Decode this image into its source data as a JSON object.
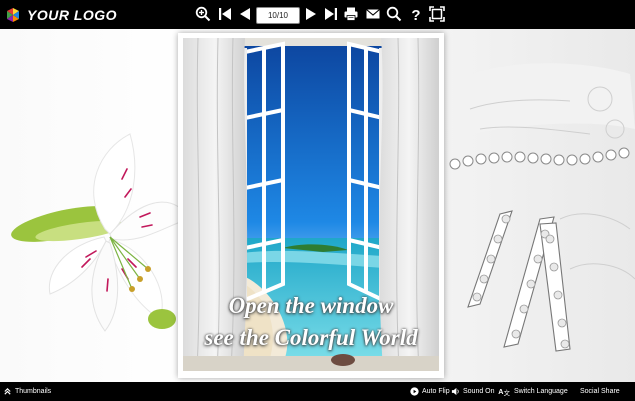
{
  "header": {
    "logo_text": "YOUR LOGO",
    "page_indicator": "10/10",
    "icons": [
      "zoom-in-icon",
      "first-page-icon",
      "previous-page-icon",
      "next-page-icon",
      "last-page-icon",
      "print-icon",
      "email-icon",
      "search-icon",
      "help-icon",
      "fullscreen-icon"
    ]
  },
  "book": {
    "caption_line1": "Open the window",
    "caption_line2": "see the Colorful World"
  },
  "footer": {
    "thumbnails_label": "Thumbnails",
    "auto_flip_label": "Auto Flip",
    "sound_label": "Sound On",
    "language_label": "Switch Language",
    "share_label": "Social Share"
  },
  "colors": {
    "toolbar_bg": "#000000",
    "sky": "#1565c8",
    "sea": "#3ec3d9"
  }
}
